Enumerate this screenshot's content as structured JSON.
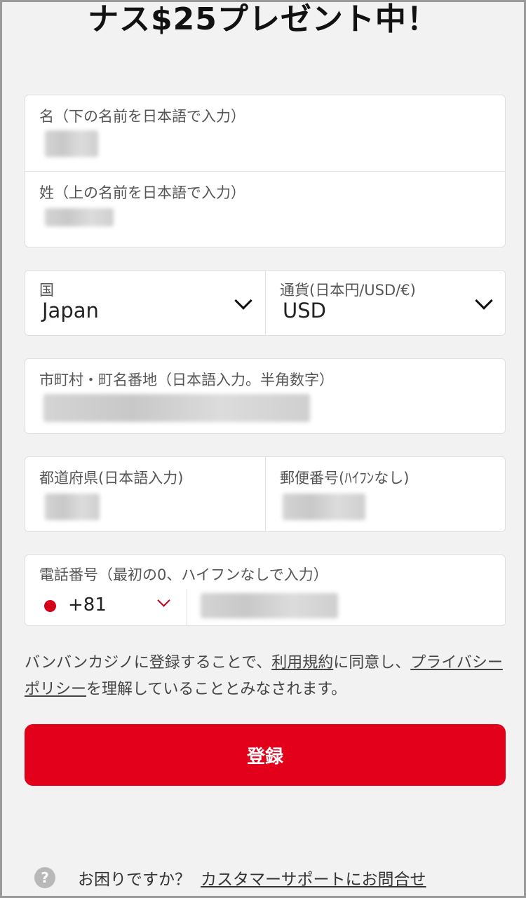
{
  "headline": "ナス$25プレゼント中！",
  "name_card": {
    "first_name_label": "名（下の名前を日本語で入力）",
    "last_name_label": "姓（上の名前を日本語で入力）"
  },
  "country_currency": {
    "country_label": "国",
    "country_value": "Japan",
    "currency_label": "通貨(日本円/USD/€)",
    "currency_value": "USD"
  },
  "address": {
    "label": "市町村・町名番地（日本語入力。半角数字）"
  },
  "prefecture_postal": {
    "prefecture_label": "都道府県(日本語入力)",
    "postal_label": "郵便番号(ﾊｲﾌﾝなし)"
  },
  "phone": {
    "label": "電話番号（最初の0、ハイフンなしで入力）",
    "country_code": "+81"
  },
  "consent": {
    "text_1": "バンバンカジノに登録することで、",
    "terms_link": "利用規約",
    "text_2": "に同意し、",
    "privacy_link": "プライバシーポリシー",
    "text_3": "を理解していることとみなされます。"
  },
  "submit_label": "登録",
  "help": {
    "question": "お困りですか？",
    "support_link": "カスタマーサポートにお問合せ"
  },
  "colors": {
    "accent": "#e3001b",
    "background": "#f2f2f2"
  }
}
